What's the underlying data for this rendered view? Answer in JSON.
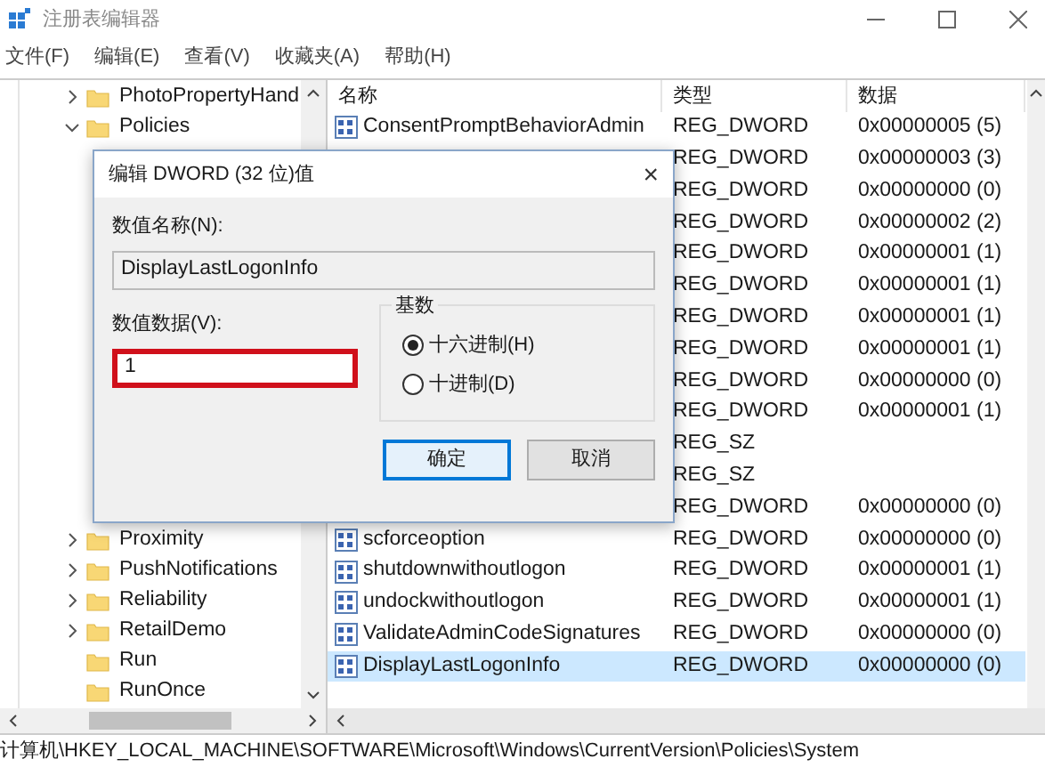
{
  "window": {
    "title": "注册表编辑器"
  },
  "menu": [
    "文件(F)",
    "编辑(E)",
    "查看(V)",
    "收藏夹(A)",
    "帮助(H)"
  ],
  "tree_top": [
    {
      "label": "PhotoPropertyHand",
      "expanded": false
    },
    {
      "label": "Policies",
      "expanded": true
    }
  ],
  "tree_bottom": [
    {
      "label": "Proximity",
      "expanded": false
    },
    {
      "label": "PushNotifications",
      "expanded": false
    },
    {
      "label": "Reliability",
      "expanded": false
    },
    {
      "label": "RetailDemo",
      "expanded": false
    },
    {
      "label": "Run"
    },
    {
      "label": "RunOnce"
    }
  ],
  "table": {
    "columns": [
      "名称",
      "类型",
      "数据"
    ],
    "rows": [
      {
        "name": "ConsentPromptBehaviorAdmin",
        "type": "REG_DWORD",
        "data": "0x00000005 (5)",
        "selected": false
      },
      {
        "type": "REG_DWORD",
        "data": "0x00000003 (3)",
        "selected": false
      },
      {
        "type": "REG_DWORD",
        "data": "0x00000000 (0)",
        "selected": false
      },
      {
        "type": "REG_DWORD",
        "data": "0x00000002 (2)",
        "selected": false
      },
      {
        "type": "REG_DWORD",
        "data": "0x00000001 (1)",
        "selected": false
      },
      {
        "type": "REG_DWORD",
        "data": "0x00000001 (1)",
        "selected": false
      },
      {
        "type": "REG_DWORD",
        "data": "0x00000001 (1)",
        "selected": false
      },
      {
        "type": "REG_DWORD",
        "data": "0x00000001 (1)",
        "selected": false
      },
      {
        "type": "REG_DWORD",
        "data": "0x00000000 (0)",
        "selected": false
      },
      {
        "type": "REG_DWORD",
        "data": "0x00000001 (1)",
        "selected": false
      },
      {
        "type": "REG_SZ",
        "selected": false
      },
      {
        "type": "REG_SZ",
        "selected": false
      },
      {
        "type": "REG_DWORD",
        "data": "0x00000000 (0)",
        "selected": false
      },
      {
        "name": "scforceoption",
        "type": "REG_DWORD",
        "data": "0x00000000 (0)",
        "selected": false
      },
      {
        "name": "shutdownwithoutlogon",
        "type": "REG_DWORD",
        "data": "0x00000001 (1)",
        "selected": false
      },
      {
        "name": "undockwithoutlogon",
        "type": "REG_DWORD",
        "data": "0x00000001 (1)",
        "selected": false
      },
      {
        "name": "ValidateAdminCodeSignatures",
        "type": "REG_DWORD",
        "data": "0x00000000 (0)",
        "selected": false
      },
      {
        "name": "DisplayLastLogonInfo",
        "type": "REG_DWORD",
        "data": "0x00000000 (0)",
        "selected": true
      }
    ]
  },
  "status_bar": "计算机\\HKEY_LOCAL_MACHINE\\SOFTWARE\\Microsoft\\Windows\\CurrentVersion\\Policies\\System",
  "dialog": {
    "title": "编辑 DWORD (32 位)值",
    "close": "×",
    "name_label": "数值名称(N):",
    "name_value": "DisplayLastLogonInfo",
    "data_label": "数值数据(V):",
    "data_value": "1",
    "data_highlighted": true,
    "base_label": "基数",
    "radios": [
      {
        "label": "十六进制(H)",
        "selected": true
      },
      {
        "label": "十进制(D)",
        "selected": false
      }
    ],
    "buttons": [
      {
        "label": "确定",
        "default": true
      },
      {
        "label": "取消",
        "default": false
      }
    ]
  }
}
